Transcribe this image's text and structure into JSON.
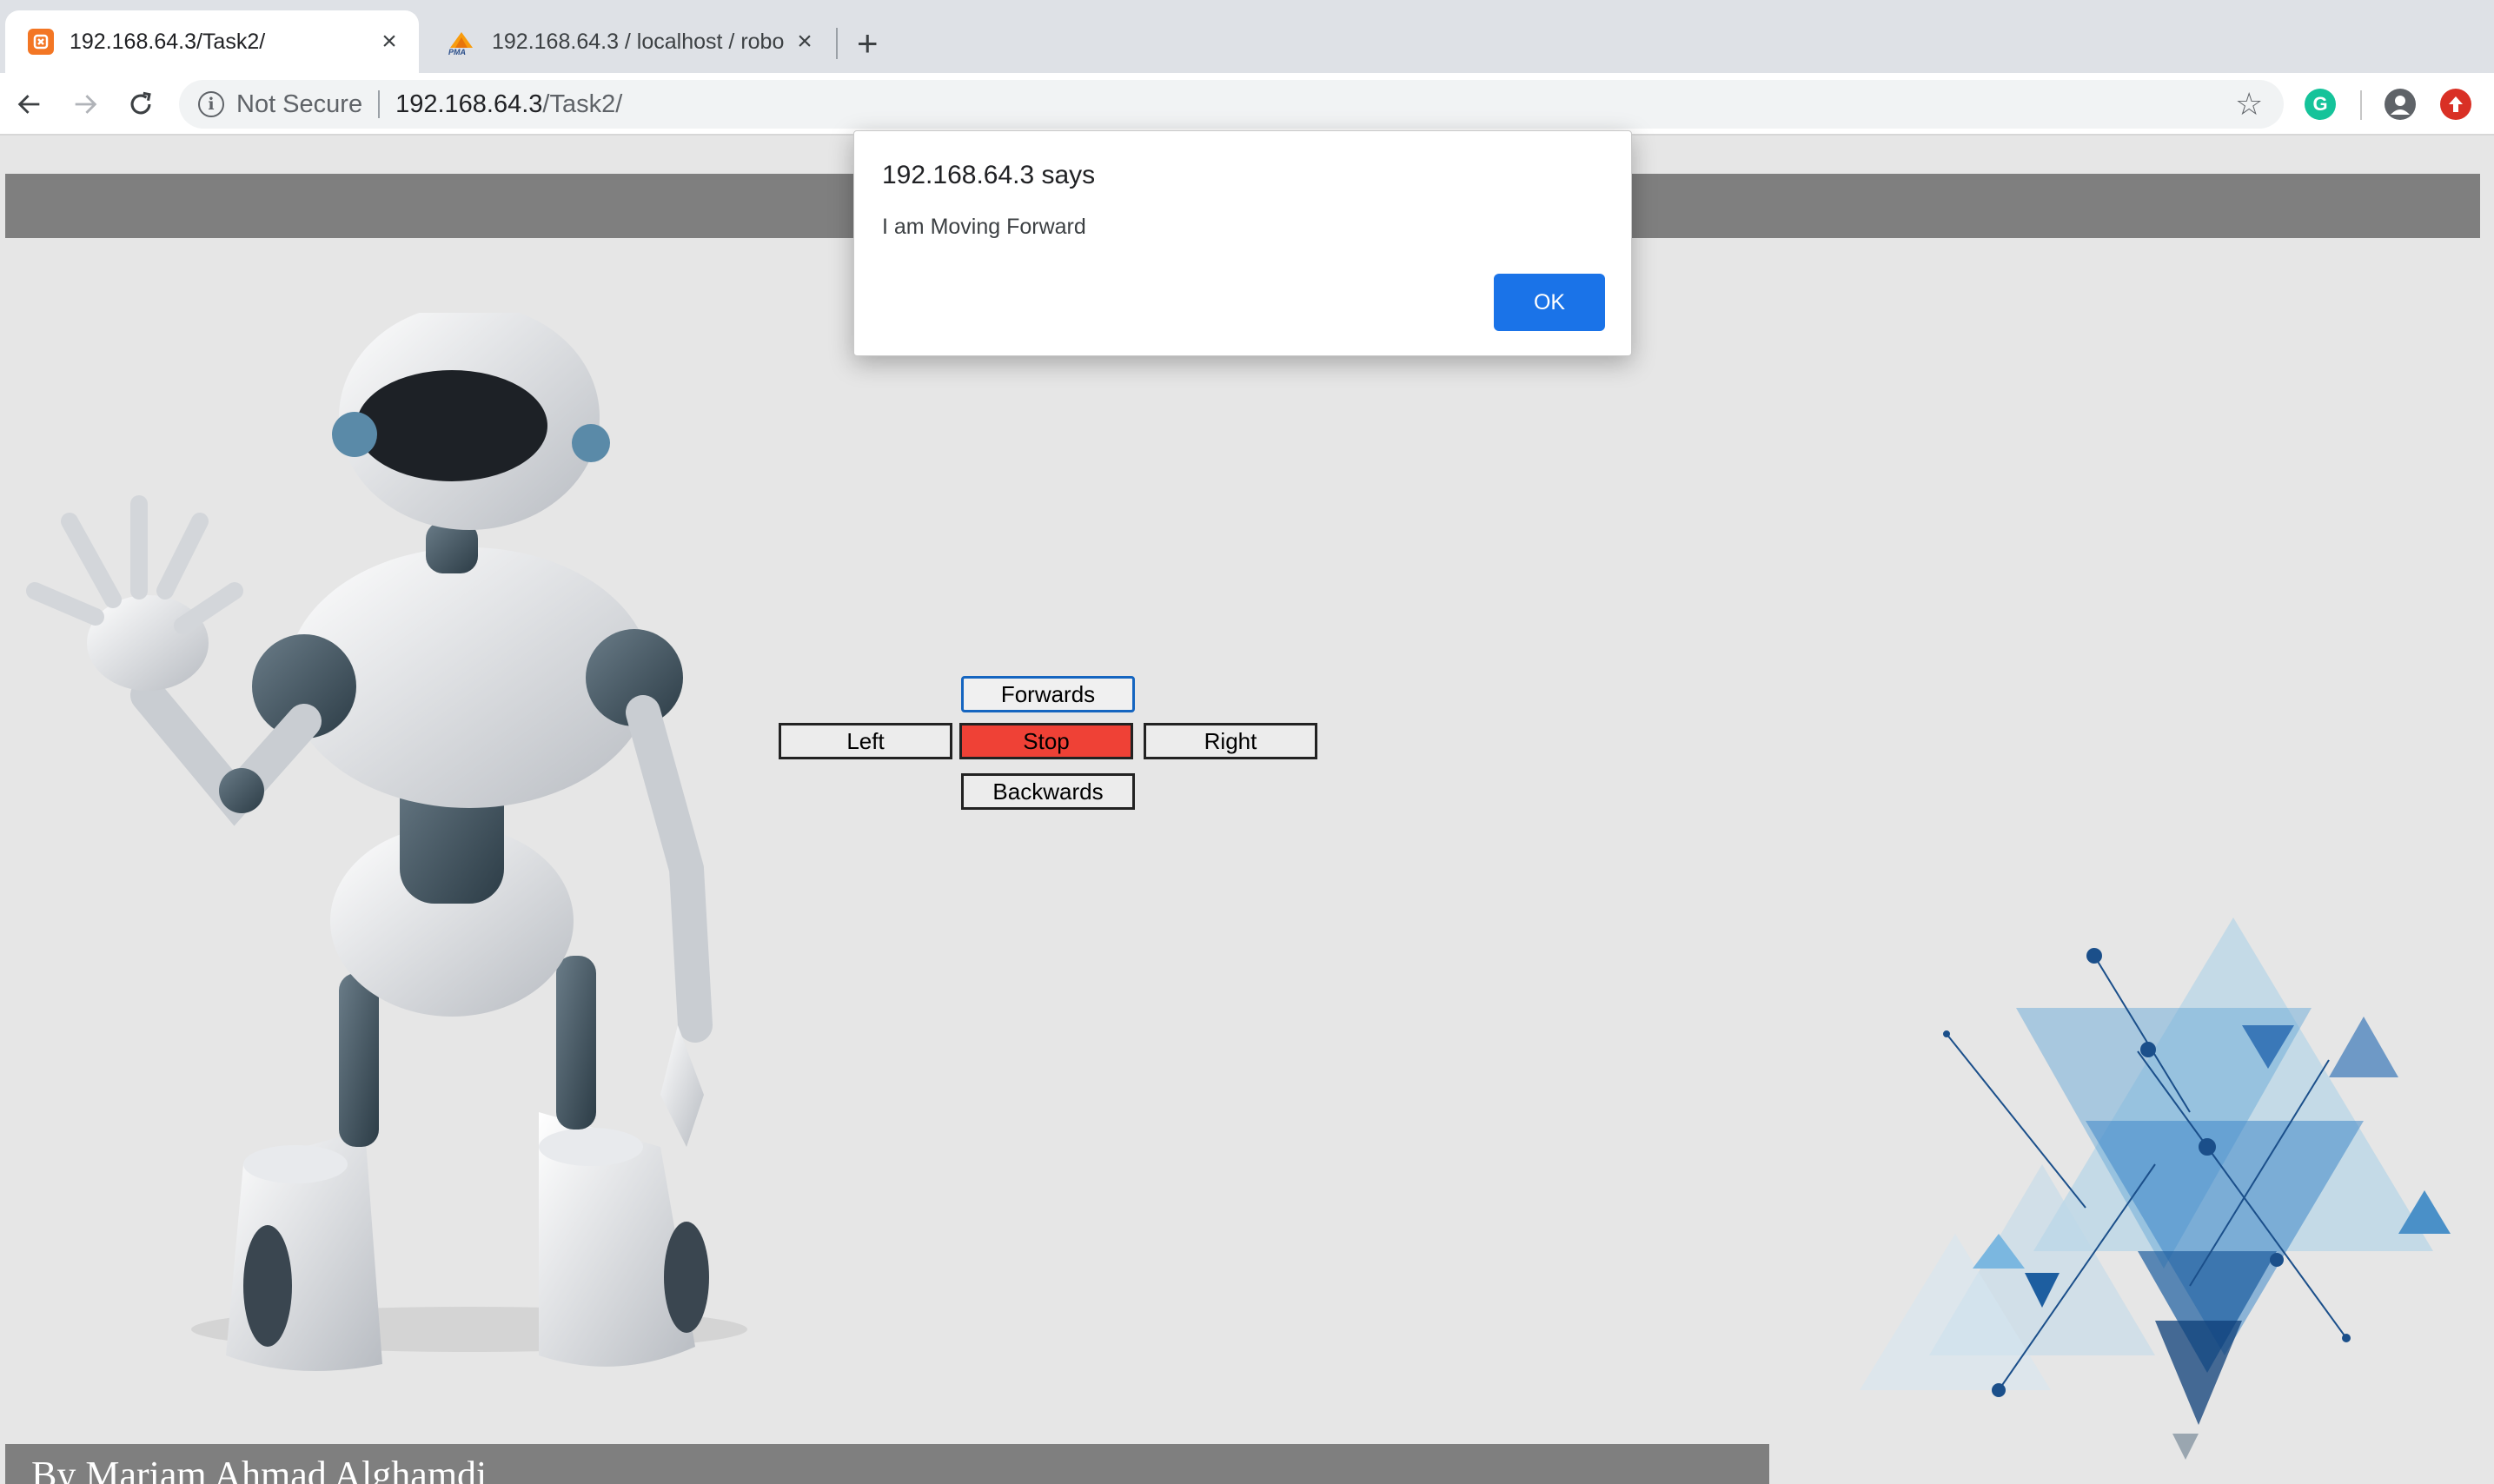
{
  "browser": {
    "tabs": [
      {
        "title": "192.168.64.3/Task2/",
        "favicon": "xampp-icon",
        "active": true
      },
      {
        "title": "192.168.64.3 / localhost / robo",
        "favicon": "phpmyadmin-icon",
        "active": false
      }
    ],
    "favicon_pma_text": "PMA",
    "new_tab_label": "+",
    "close_glyph": "×",
    "address": {
      "security_label": "Not Secure",
      "host": "192.168.64.3",
      "path": "/Task2/"
    },
    "extensions": {
      "grammarly_letter": "G"
    }
  },
  "page": {
    "controls": {
      "forward": "Forwards",
      "left": "Left",
      "stop": "Stop",
      "right": "Right",
      "backward": "Backwards"
    },
    "footer_text": "By Mariam Ahmad Alghamdi",
    "colors": {
      "background": "#e6e6e6",
      "bars": "#7f7f7f",
      "stop_button": "#ef4136",
      "focus_outline": "#1565c0"
    }
  },
  "dialog": {
    "title": "192.168.64.3 says",
    "message": "I am Moving Forward",
    "ok_label": "OK",
    "ok_color": "#1a73e8"
  }
}
